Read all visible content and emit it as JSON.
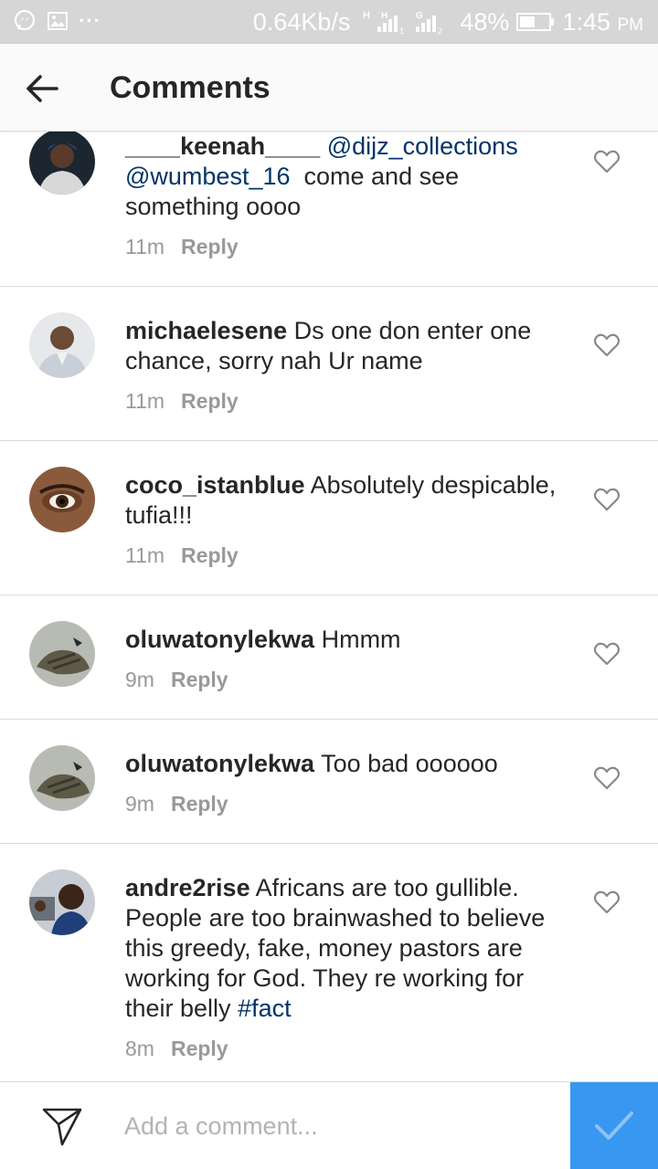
{
  "status_bar": {
    "speed": "0.64Kb/s",
    "battery": "48%",
    "time": "1:45",
    "time_suffix": "PM",
    "icons": [
      "messenger-icon",
      "gallery-icon",
      "more-dots-icon",
      "signal-h-icon",
      "signal-g-icon",
      "battery-icon"
    ]
  },
  "header": {
    "title": "Comments",
    "back_icon": "arrow-left-icon"
  },
  "comments": [
    {
      "username": "____keenah____",
      "text_parts": [
        "@dijz_collections",
        "@wumbest_16",
        "come and see something oooo"
      ],
      "time": "11m",
      "reply": "Reply"
    },
    {
      "username": "michaelesene",
      "text": "Ds one don enter one chance, sorry nah Ur name",
      "time": "11m",
      "reply": "Reply"
    },
    {
      "username": "coco_istanblue",
      "text": "Absolutely despicable, tufia!!!",
      "time": "11m",
      "reply": "Reply"
    },
    {
      "username": "oluwatonylekwa",
      "text": "Hmmm",
      "time": "9m",
      "reply": "Reply"
    },
    {
      "username": "oluwatonylekwa",
      "text": "Too bad oooooo",
      "time": "9m",
      "reply": "Reply"
    },
    {
      "username": "andre2rise",
      "text": "Africans are too gullible. People are too brainwashed to believe this greedy, fake, money pastors are working for God. They re working for their belly",
      "hashtag": "#fact",
      "time": "8m",
      "reply": "Reply"
    }
  ],
  "footer": {
    "placeholder": "Add a comment...",
    "send_icon": "paper-plane-icon",
    "post_icon": "checkmark-icon"
  },
  "colors": {
    "accent": "#3897f0",
    "mention": "#003569",
    "meta": "#999999",
    "text": "#262626",
    "status_bar": "#d6d6d6"
  }
}
